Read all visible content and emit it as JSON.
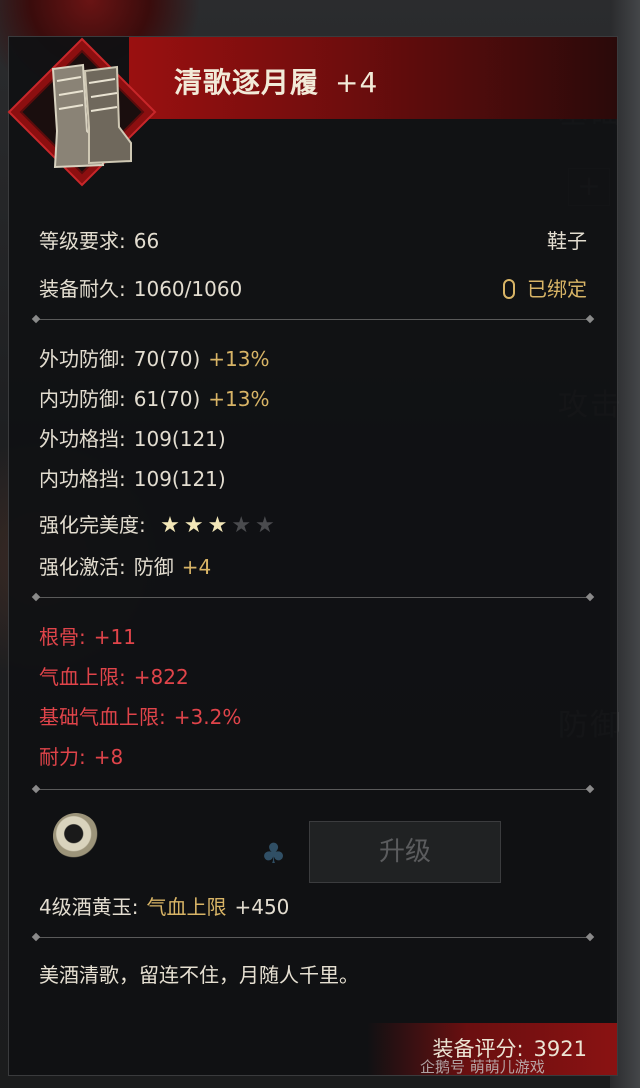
{
  "item": {
    "name": "清歌逐月履",
    "enhance": "+4"
  },
  "info": {
    "level_label": "等级要求:",
    "level_value": "66",
    "slot": "鞋子",
    "durability_label": "装备耐久:",
    "durability_value": "1060/1060",
    "bind_status": "已绑定"
  },
  "stats": [
    {
      "label": "外功防御:",
      "value": "70(70)",
      "bonus": "+13%"
    },
    {
      "label": "内功防御:",
      "value": "61(70)",
      "bonus": "+13%"
    },
    {
      "label": "外功格挡:",
      "value": "109(121)",
      "bonus": ""
    },
    {
      "label": "内功格挡:",
      "value": "109(121)",
      "bonus": ""
    }
  ],
  "perfection": {
    "label": "强化完美度:",
    "stars_filled": 3,
    "stars_total": 5
  },
  "activation": {
    "label": "强化激活:",
    "type": "防御",
    "bonus": "+4"
  },
  "attributes": [
    {
      "label": "根骨:",
      "value": "+11"
    },
    {
      "label": "气血上限:",
      "value": "+822"
    },
    {
      "label": "基础气血上限:",
      "value": "+3.2%"
    },
    {
      "label": "耐力:",
      "value": "+8"
    }
  ],
  "gem": {
    "label": "4级酒黄玉:",
    "attr": "气血上限",
    "value": "+450",
    "icon": "jade-ring-icon"
  },
  "upgrade_button": "升级",
  "description": "美酒清歌，留连不住，月随人千里。",
  "score": {
    "label": "装备评分:",
    "value": "3921"
  },
  "background_labels": [
    "基础",
    "攻击",
    "防御"
  ],
  "watermark": "企鹅号 萌萌儿游戏",
  "colors": {
    "title_bar": "#9a1010",
    "gold": "#d8b466",
    "red_attr": "#e0444a"
  }
}
